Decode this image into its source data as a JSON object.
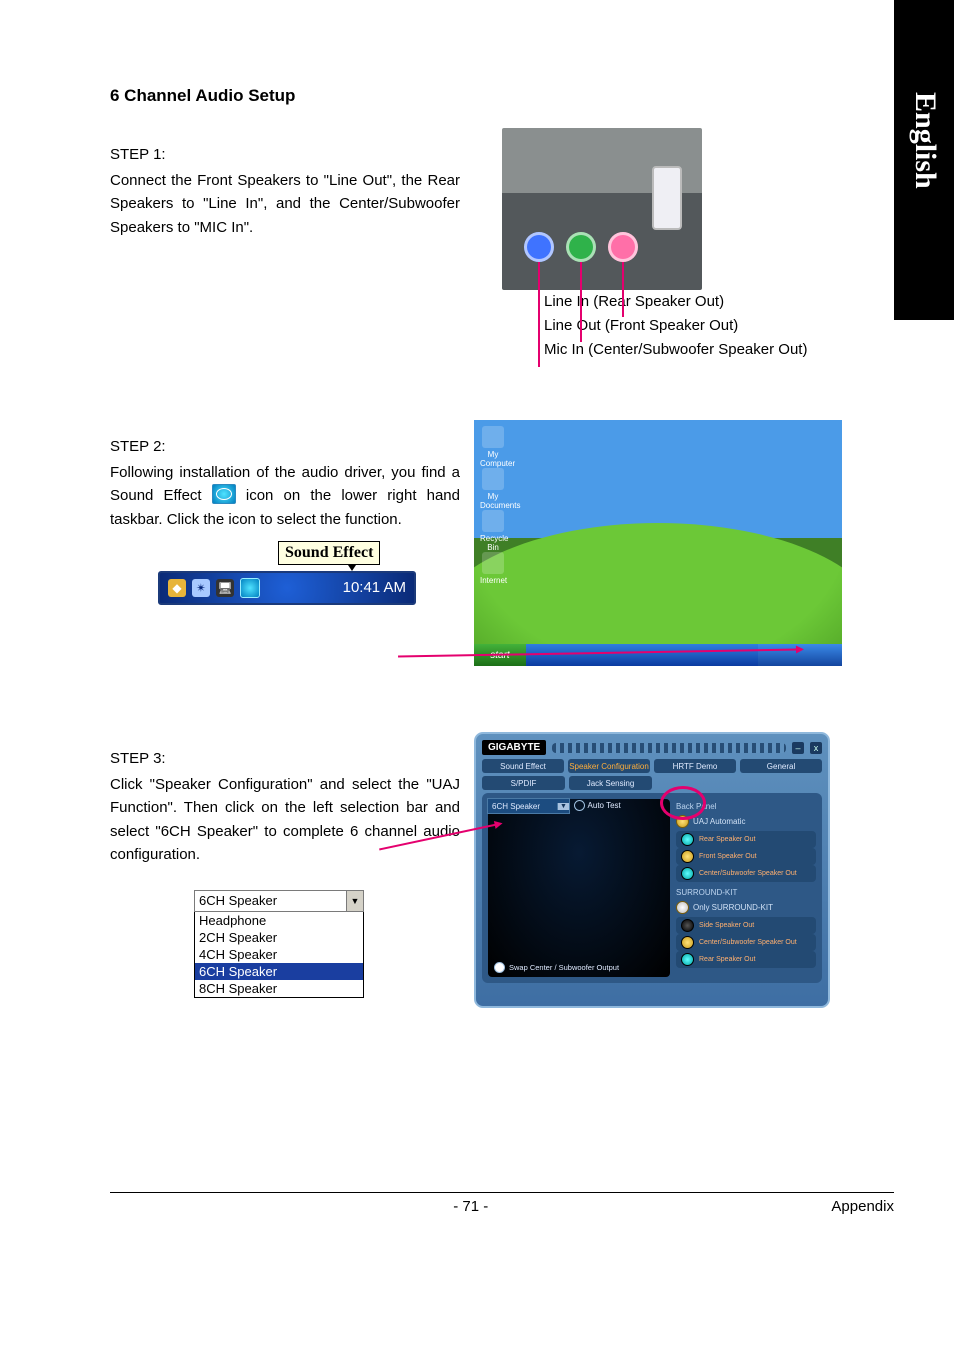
{
  "side_tab": "English",
  "title": "6 Channel Audio Setup",
  "step1": {
    "label": "STEP 1:",
    "text": "Connect the Front Speakers to \"Line Out\", the Rear Speakers to \"Line In\", and the Center/Subwoofer Speakers to \"MIC In\"."
  },
  "photo1_labels": {
    "a": "Line In (Rear Speaker Out)",
    "b": "Line Out (Front Speaker Out)",
    "c": "Mic In (Center/Subwoofer Speaker Out)"
  },
  "step2": {
    "label": "STEP 2:",
    "pre": "Following installation of the audio driver, you find a Sound Effect ",
    "post": " icon on the lower right hand taskbar. Click the icon to select the function."
  },
  "tooltip": "Sound Effect",
  "clock": "10:41 AM",
  "start": "start",
  "step3": {
    "label": "STEP 3:",
    "text": "Click \"Speaker Configuration\" and select the \"UAJ Function\".  Then click on the left selection bar and select \"6CH Speaker\" to complete 6 channel audio configuration."
  },
  "dropdown": {
    "selected": "6CH Speaker",
    "options": [
      "Headphone",
      "2CH Speaker",
      "4CH Speaker",
      "6CH Speaker",
      "8CH Speaker"
    ],
    "highlight_index": 3
  },
  "panel": {
    "brand": "GIGABYTE",
    "tabs_row1": [
      "Sound Effect",
      "Speaker Configuration",
      "HRTF Demo",
      "General"
    ],
    "tabs_row2": [
      "S/PDIF",
      "Jack Sensing"
    ],
    "room_sel": "6CH Speaker",
    "auto_test": "Auto Test",
    "back_panel": "Back Panel",
    "uaj": "UAJ Automatic",
    "rows_a": [
      "Rear Speaker Out",
      "Front Speaker Out",
      "Center/Subwoofer Speaker Out"
    ],
    "kit_hdr": "SURROUND-KIT",
    "kit_sub": "Only SURROUND-KIT",
    "rows_b": [
      "Side Speaker Out",
      "Center/Subwoofer Speaker Out",
      "Rear Speaker Out"
    ],
    "swap": "Swap Center / Subwoofer Output"
  },
  "footer": {
    "page": "- 71 -",
    "section": "Appendix"
  }
}
